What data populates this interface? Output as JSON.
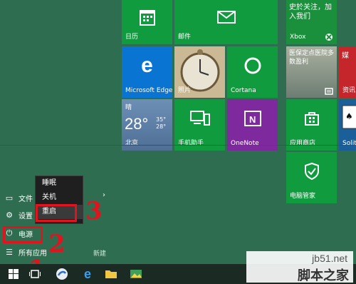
{
  "tiles": {
    "calendar": "日历",
    "mail": "邮件",
    "edge": "Microsoft Edge",
    "photos": "照片",
    "cortana": "Cortana",
    "phone": "手机助手",
    "onenote": "OneNote",
    "xbox": "Xbox",
    "news": "医保定点医院多数盈利",
    "info": "资讯",
    "store": "应用商店",
    "pcmanager": "电脑管家",
    "solitaire": "Solita",
    "top_right": "史於关注，加入我们"
  },
  "weather": {
    "label": "晴",
    "temp": "28°",
    "high": "35°",
    "low": "28°",
    "city": "北京"
  },
  "start_menu": {
    "file_explorer": "文件",
    "settings": "设置",
    "power": "电源",
    "all_apps": "所有应用",
    "new": "新建"
  },
  "power_menu": {
    "sleep": "睡眠",
    "shutdown": "关机",
    "restart": "重启"
  },
  "annotations": {
    "step1": "1",
    "step2": "2",
    "step3": "3"
  },
  "watermark": {
    "site": "jb51.net",
    "name": "脚本之家"
  }
}
